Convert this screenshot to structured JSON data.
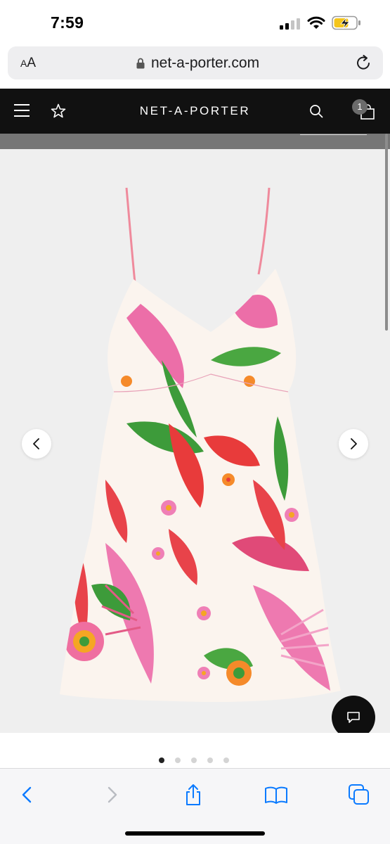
{
  "status_bar": {
    "time": "7:59"
  },
  "browser": {
    "text_size_label_small": "A",
    "text_size_label_large": "A",
    "url": "net-a-porter.com"
  },
  "header": {
    "logo": "NET-A-PORTER",
    "bag_count": "1"
  },
  "gallery": {
    "image_count": 5,
    "active_index": 0
  },
  "colors": {
    "header_bg": "#111111",
    "gallery_bg": "#efefef",
    "accent_ios_blue": "#0a7aff"
  },
  "icons": [
    "menu-icon",
    "star-icon",
    "search-icon",
    "bag-icon",
    "chevron-left-icon",
    "chevron-right-icon",
    "chat-icon",
    "share-icon",
    "bookmarks-icon",
    "tabs-icon",
    "reload-icon",
    "lock-icon"
  ]
}
